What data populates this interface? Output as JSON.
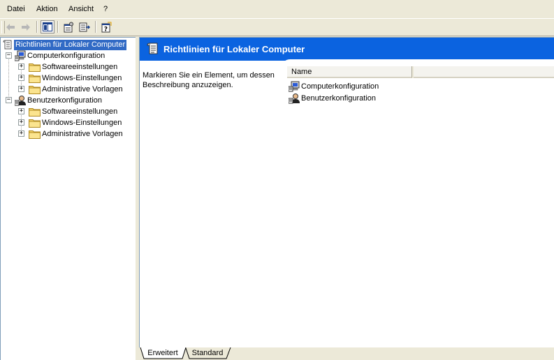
{
  "menu": {
    "items": [
      "Datei",
      "Aktion",
      "Ansicht",
      "?"
    ]
  },
  "toolbar": {
    "buttons": [
      "back-icon",
      "forward-icon",
      "show-hide-tree-icon",
      "properties-icon",
      "export-list-icon",
      "help-icon"
    ]
  },
  "tree": {
    "root": "Richtlinien für Lokaler Computer",
    "computer": {
      "label": "Computerkonfiguration",
      "children": [
        "Softwareeinstellungen",
        "Windows-Einstellungen",
        "Administrative Vorlagen"
      ]
    },
    "user": {
      "label": "Benutzerkonfiguration",
      "children": [
        "Softwareeinstellungen",
        "Windows-Einstellungen",
        "Administrative Vorlagen"
      ]
    },
    "expander_collapsed": "+",
    "expander_expanded": "−"
  },
  "main": {
    "title": "Richtlinien für Lokaler Computer",
    "description": "Markieren Sie ein Element, um dessen Beschreibung anzuzeigen.",
    "column_name": "Name",
    "items": [
      "Computerkonfiguration",
      "Benutzerkonfiguration"
    ]
  },
  "tabs": [
    "Erweitert",
    "Standard"
  ],
  "colors": {
    "banner": "#0b63e0",
    "selection": "#316ac5",
    "folder": "#f4d36b"
  }
}
